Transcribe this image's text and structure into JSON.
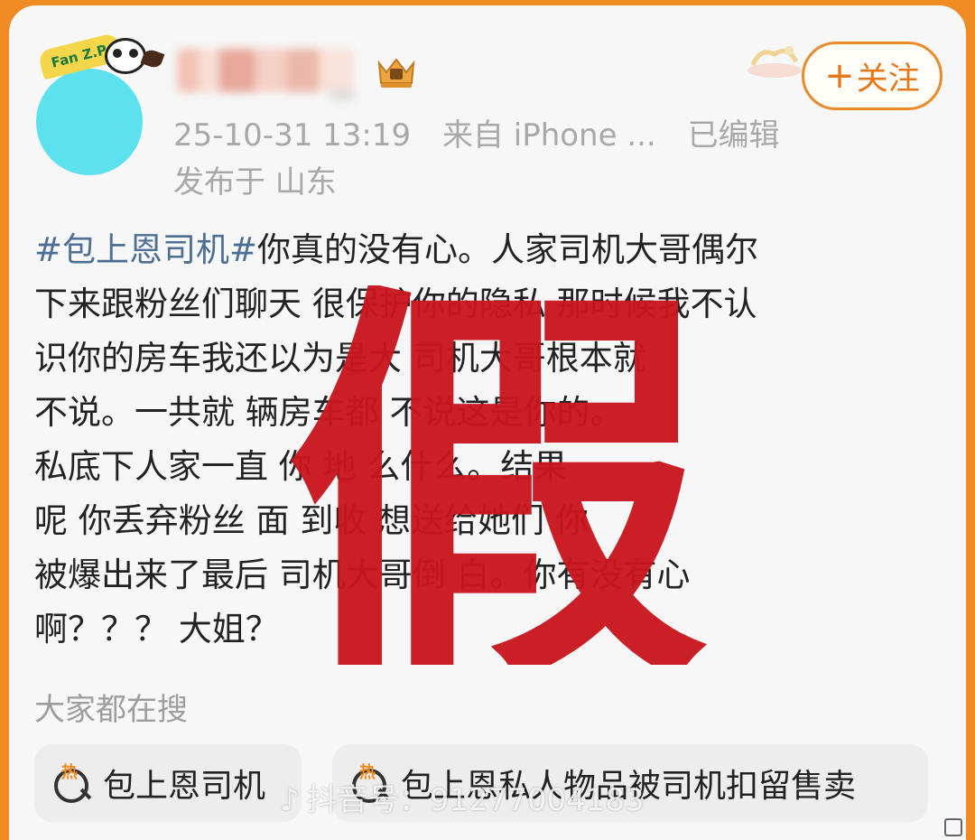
{
  "post": {
    "avatar_tag": "Fan Z.P.",
    "follow_label": "关注",
    "follow_plus": "+",
    "timestamp": "25-10-31 13:19",
    "source": "来自 iPhone ...",
    "edited": "已编辑",
    "location": "发布于 山东",
    "body_lines": [
      {
        "hashtag": "#包上恩司机#",
        "text": "你真的没有心。人家司机大哥偶尔"
      },
      {
        "text": "下来跟粉丝们聊天 很保护你的隐私 那时候我不认"
      },
      {
        "text": "识你的房车我还以为是大 司机大哥根本就"
      },
      {
        "text": "不说。一共就 辆房车都 不说这是你的。"
      },
      {
        "text": "私底下人家一直 你 地 么什么。结果"
      },
      {
        "text": "呢 你丢弃粉丝 面 到收 想送给她们 你"
      },
      {
        "text": "被爆出来了最后 司机大哥倒 白。你有没有心"
      },
      {
        "text": "啊？？？ 大姐？"
      }
    ],
    "stamp_text": "假",
    "stamp_color": "#c8161d"
  },
  "search": {
    "title": "大家都在搜",
    "hot_badge": "热",
    "chips": [
      {
        "label": "包上恩司机"
      },
      {
        "label": "包上恩私人物品被司机扣留售卖"
      }
    ]
  },
  "watermark": {
    "logo": "♪",
    "text": "抖音号：91277004183"
  },
  "colors": {
    "accent": "#e8761a",
    "hashtag": "#4d6f96",
    "frame": "#f08a22"
  }
}
